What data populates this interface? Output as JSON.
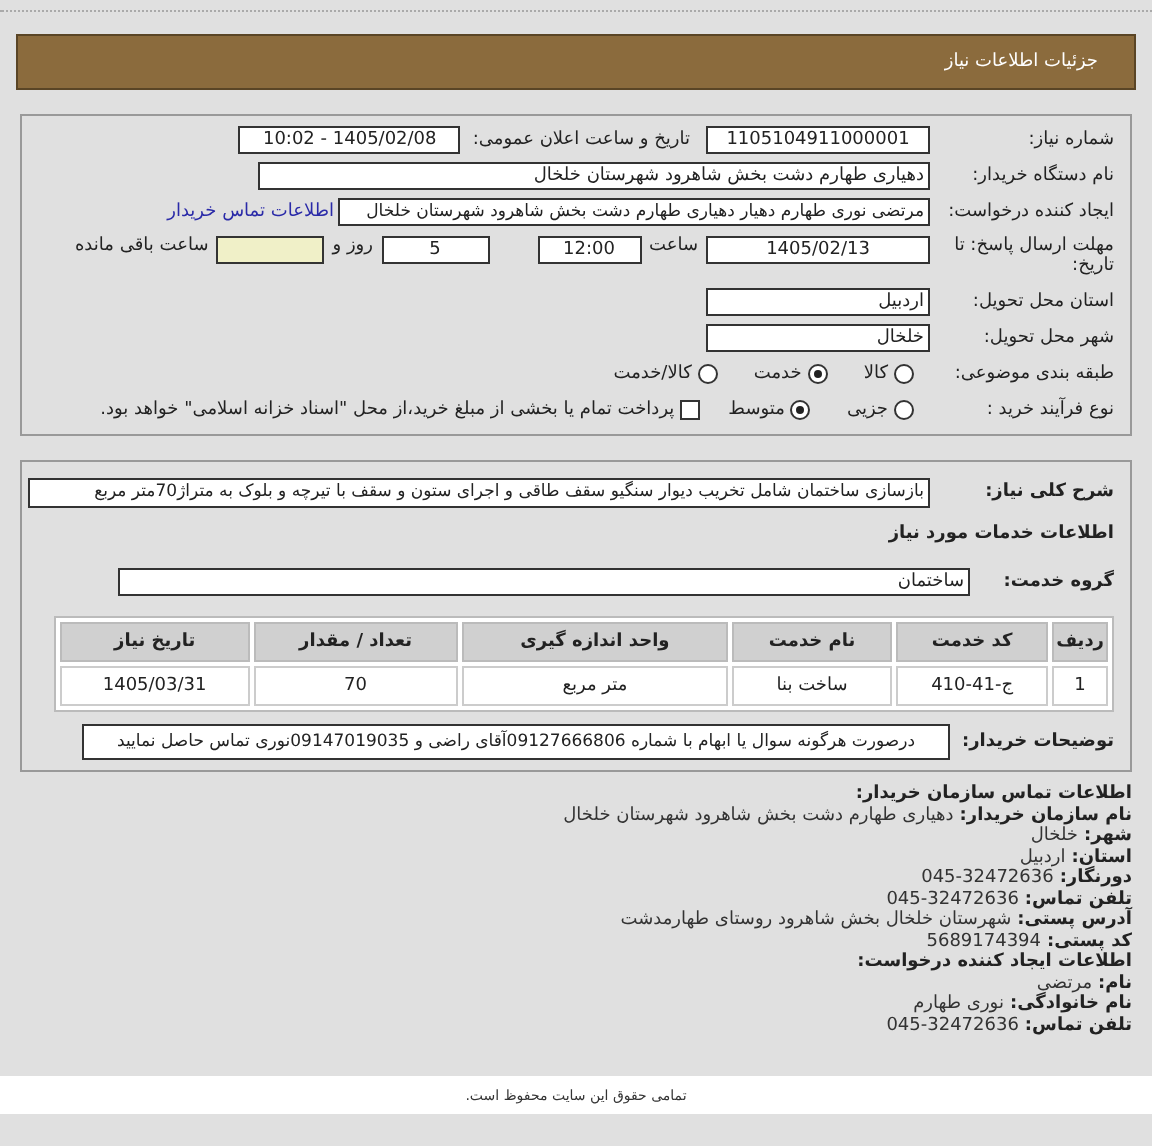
{
  "header": {
    "title": "جزئیات اطلاعات نیاز"
  },
  "details": [
    {
      "kind": "double",
      "label": "شماره نیاز:",
      "value": "1105104911000001",
      "label2": "تاریخ و ساعت اعلان عمومی:",
      "value2": "1405/02/08 - 10:02"
    },
    {
      "kind": "field",
      "label": "نام دستگاه خریدار:",
      "value": "دهیاری طهارم دشت بخش شاهرود شهرستان خلخال"
    },
    {
      "kind": "field_link",
      "label": "ایجاد کننده درخواست:",
      "value": "مرتضی نوری طهارم دهیار دهیاری طهارم دشت بخش شاهرود شهرستان خلخال",
      "link": "اطلاعات تماس خریدار"
    },
    {
      "kind": "deadline",
      "label": "مهلت ارسال پاسخ: تا تاریخ:",
      "date": "1405/02/13",
      "time_label": "ساعت",
      "time": "12:00",
      "days": "5",
      "days_label": "روز و",
      "hours_label": "ساعت باقی مانده"
    },
    {
      "kind": "short_field",
      "label": "استان محل تحویل:",
      "value": "اردبیل"
    },
    {
      "kind": "short_field",
      "label": "شهر محل تحویل:",
      "value": "خلخال"
    },
    {
      "kind": "radios",
      "label": "طبقه بندی موضوعی:",
      "options": [
        {
          "label": "کالا",
          "selected": false
        },
        {
          "label": "خدمت",
          "selected": true
        },
        {
          "label": "کالا/خدمت",
          "selected": false
        }
      ]
    },
    {
      "kind": "radios",
      "label": "نوع فرآیند خرید :",
      "options": [
        {
          "label": "جزیی",
          "selected": false
        },
        {
          "label": "متوسط",
          "selected": true
        }
      ],
      "checkbox": {
        "label": "پرداخت تمام یا بخشی از مبلغ خرید،از محل \"اسناد خزانه اسلامی\" خواهد بود.",
        "checked": false
      }
    }
  ],
  "description": {
    "label": "شرح کلی نیاز:",
    "value": "بازسازی ساختمان شامل تخریب دیوار سنگیو سقف طاقی و اجرای ستون و سقف با تیرچه و بلوک به متراژ70متر مربع"
  },
  "services_title": "اطلاعات خدمات مورد نیاز",
  "service_group": {
    "label": "گروه خدمت:",
    "value": "ساختمان"
  },
  "table": {
    "columns": [
      "ردیف",
      "کد خدمت",
      "نام خدمت",
      "واحد اندازه گیری",
      "تعداد / مقدار",
      "تاریخ نیاز"
    ],
    "rows": [
      [
        "1",
        "ج-41-410",
        "ساخت بنا",
        "متر مربع",
        "70",
        "1405/03/31"
      ]
    ]
  },
  "buyer_notes": {
    "label": "توضیحات خریدار:",
    "value": "درصورت هرگونه سوال یا ابهام با شماره 09127666806آقای راضی و 09147019035نوری تماس حاصل نمایید"
  },
  "contact": {
    "title": "اطلاعات تماس سازمان خریدار:",
    "lines": [
      {
        "label": "نام سازمان خریدار:",
        "value": "دهیاری طهارم دشت بخش شاهرود شهرستان خلخال"
      },
      {
        "label": "شهر:",
        "value": "خلخال"
      },
      {
        "label": "استان:",
        "value": "اردبیل"
      },
      {
        "label": "دورنگار:",
        "value": "045-32472636"
      },
      {
        "label": "تلفن تماس:",
        "value": "045-32472636"
      },
      {
        "label": "آدرس پستی:",
        "value": "شهرستان خلخال بخش شاهرود روستای طهارمدشت"
      },
      {
        "label": "کد پستی:",
        "value": "5689174394"
      }
    ],
    "creator_title": "اطلاعات ایجاد کننده درخواست:",
    "creator_lines": [
      {
        "label": "نام:",
        "value": "مرتضی"
      },
      {
        "label": "نام خانوادگی:",
        "value": "نوری طهارم"
      },
      {
        "label": "تلفن تماس:",
        "value": "045-32472636"
      }
    ]
  },
  "footer": "تمامی حقوق این سایت محفوظ است."
}
